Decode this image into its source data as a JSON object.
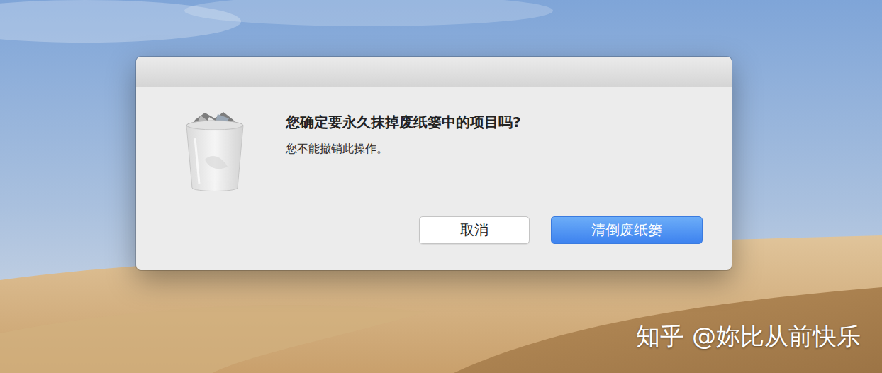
{
  "dialog": {
    "heading": "您确定要永久抹掉废纸篓中的项目吗?",
    "message": "您不能撤销此操作。",
    "buttons": [
      {
        "label": "取消",
        "default": false
      },
      {
        "label": "清倒废纸篓",
        "default": true
      }
    ]
  },
  "watermark": "知乎 @妳比从前快乐"
}
